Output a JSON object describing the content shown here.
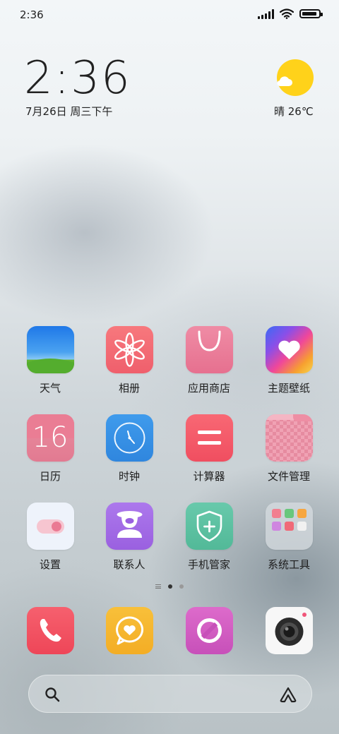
{
  "status_bar": {
    "time": "2:36",
    "icons": [
      "signal-icon",
      "wifi-icon",
      "battery-icon"
    ]
  },
  "clock_widget": {
    "time": "2:36",
    "date": "7月26日 周三下午"
  },
  "weather_widget": {
    "icon": "sunny-cloud-icon",
    "text": "晴 26℃"
  },
  "apps": [
    {
      "label": "天气",
      "icon": "weather-icon"
    },
    {
      "label": "相册",
      "icon": "gallery-icon"
    },
    {
      "label": "应用商店",
      "icon": "app-store-icon"
    },
    {
      "label": "主题壁纸",
      "icon": "themes-icon"
    },
    {
      "label": "日历",
      "icon": "calendar-icon",
      "icon_text": "16"
    },
    {
      "label": "时钟",
      "icon": "clock-icon"
    },
    {
      "label": "计算器",
      "icon": "calculator-icon"
    },
    {
      "label": "文件管理",
      "icon": "file-manager-icon"
    },
    {
      "label": "设置",
      "icon": "settings-icon"
    },
    {
      "label": "联系人",
      "icon": "contacts-icon"
    },
    {
      "label": "手机管家",
      "icon": "security-icon"
    },
    {
      "label": "系统工具",
      "icon": "system-tools-folder-icon"
    }
  ],
  "page_indicator": {
    "pages": 2,
    "current": 1
  },
  "dock": [
    {
      "icon": "phone-icon"
    },
    {
      "icon": "messages-icon"
    },
    {
      "icon": "browser-icon"
    },
    {
      "icon": "camera-icon"
    }
  ],
  "search_bar": {
    "left_icon": "search-icon",
    "right_icon": "assistant-icon"
  },
  "colors": {
    "text": "#222222",
    "weather_sun": "#FFD21A",
    "gallery": "#F36B73",
    "app_store": "#EB7F9C",
    "calendar": "#E88296",
    "clock": "#3A93E6",
    "calculator": "#F55E6B",
    "contacts": "#A46DE5",
    "security": "#5CC1A2",
    "phone": "#F15163",
    "messages": "#F6B62F",
    "browser": "#D65CC4"
  }
}
